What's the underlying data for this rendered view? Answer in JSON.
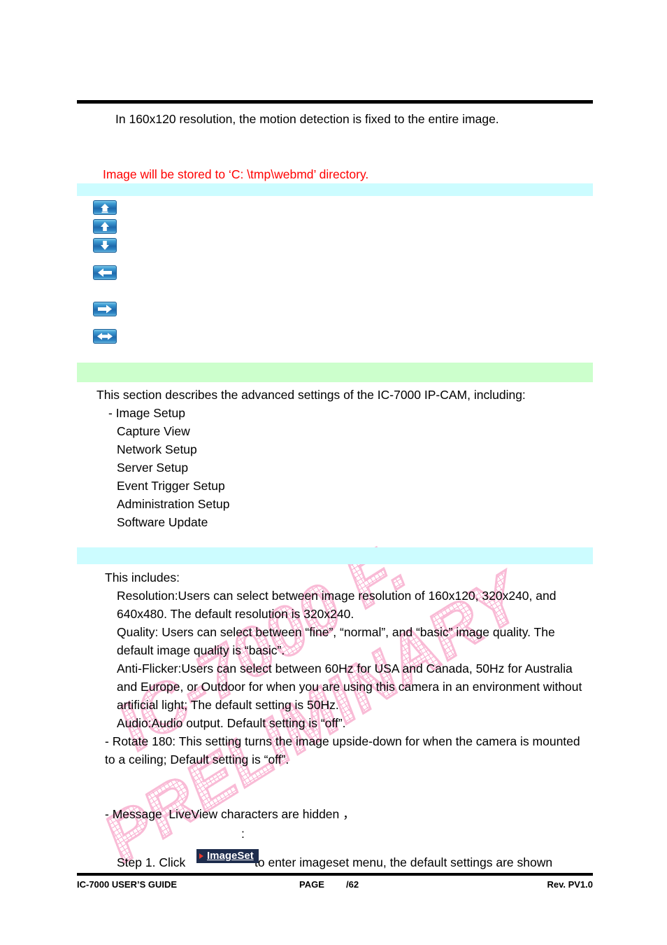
{
  "document": {
    "note_top": "In 160x120 resolution, the motion detection is fixed to the entire image.",
    "note_red": "Image will be stored to ‘C: \\tmp\\webmd’ directory."
  },
  "nav_icons": [
    {
      "name": "home-icon",
      "glyph": "home"
    },
    {
      "name": "arrow-up-icon",
      "glyph": "up"
    },
    {
      "name": "arrow-down-icon",
      "glyph": "down"
    },
    {
      "name": "arrow-left-icon",
      "glyph": "left"
    },
    {
      "name": "arrow-right-icon",
      "glyph": "right"
    },
    {
      "name": "arrow-left-right-icon",
      "glyph": "leftright"
    }
  ],
  "section_advanced": {
    "bar_label": "",
    "intro": "This section describes the advanced settings of the IC-7000 IP-CAM, including:",
    "items": [
      "- Image Setup",
      "Capture View",
      "Network Setup",
      "Server Setup",
      "Event Trigger Setup",
      "Administration Setup",
      "Software Update"
    ]
  },
  "section_imagesetup": {
    "bar_label": "",
    "intro": "This includes:",
    "lines": [
      "Resolution:Users can select between image resolution of 160x120, 320x240, and",
      "640x480. The default resolution is 320x240.",
      "Quality: Users can select between “fine”, “normal”, and “basic” image quality. The",
      "default image quality is “basic”.",
      "Anti-Flicker:Users can select between 60Hz for USA and Canada, 50Hz for Australia",
      "and Europe, or Outdoor for when you are using this camera in an environment without",
      "artificial light; The default setting is 50Hz.",
      "Audio:Audio output. Default setting is “off”.",
      "- Rotate 180: This setting turns the image upside-down for when the camera is mounted",
      "to a ceiling; Default setting is “off”."
    ],
    "message_line": "- Message  LiveView characters are hidden ，",
    "colon_line": ":",
    "step_prefix": "Step 1. Click",
    "step_button": "ImageSet",
    "step_suffix": "to enter imageset menu, the default settings are shown"
  },
  "watermark": {
    "line1": "IC-7000 F.",
    "line2": "PRELIMINARY",
    "color": "#f9a8cd"
  },
  "footer": {
    "left": "IC-7000 USER’S GUIDE",
    "page_label": "PAGE",
    "page_value": "/62",
    "right": "Rev. PV1.0"
  },
  "colors": {
    "cyan_bar": "#ccfcff",
    "green_bar": "#ccffcc",
    "red_text": "#ff0000",
    "button_bg": "#1e2d4d"
  }
}
